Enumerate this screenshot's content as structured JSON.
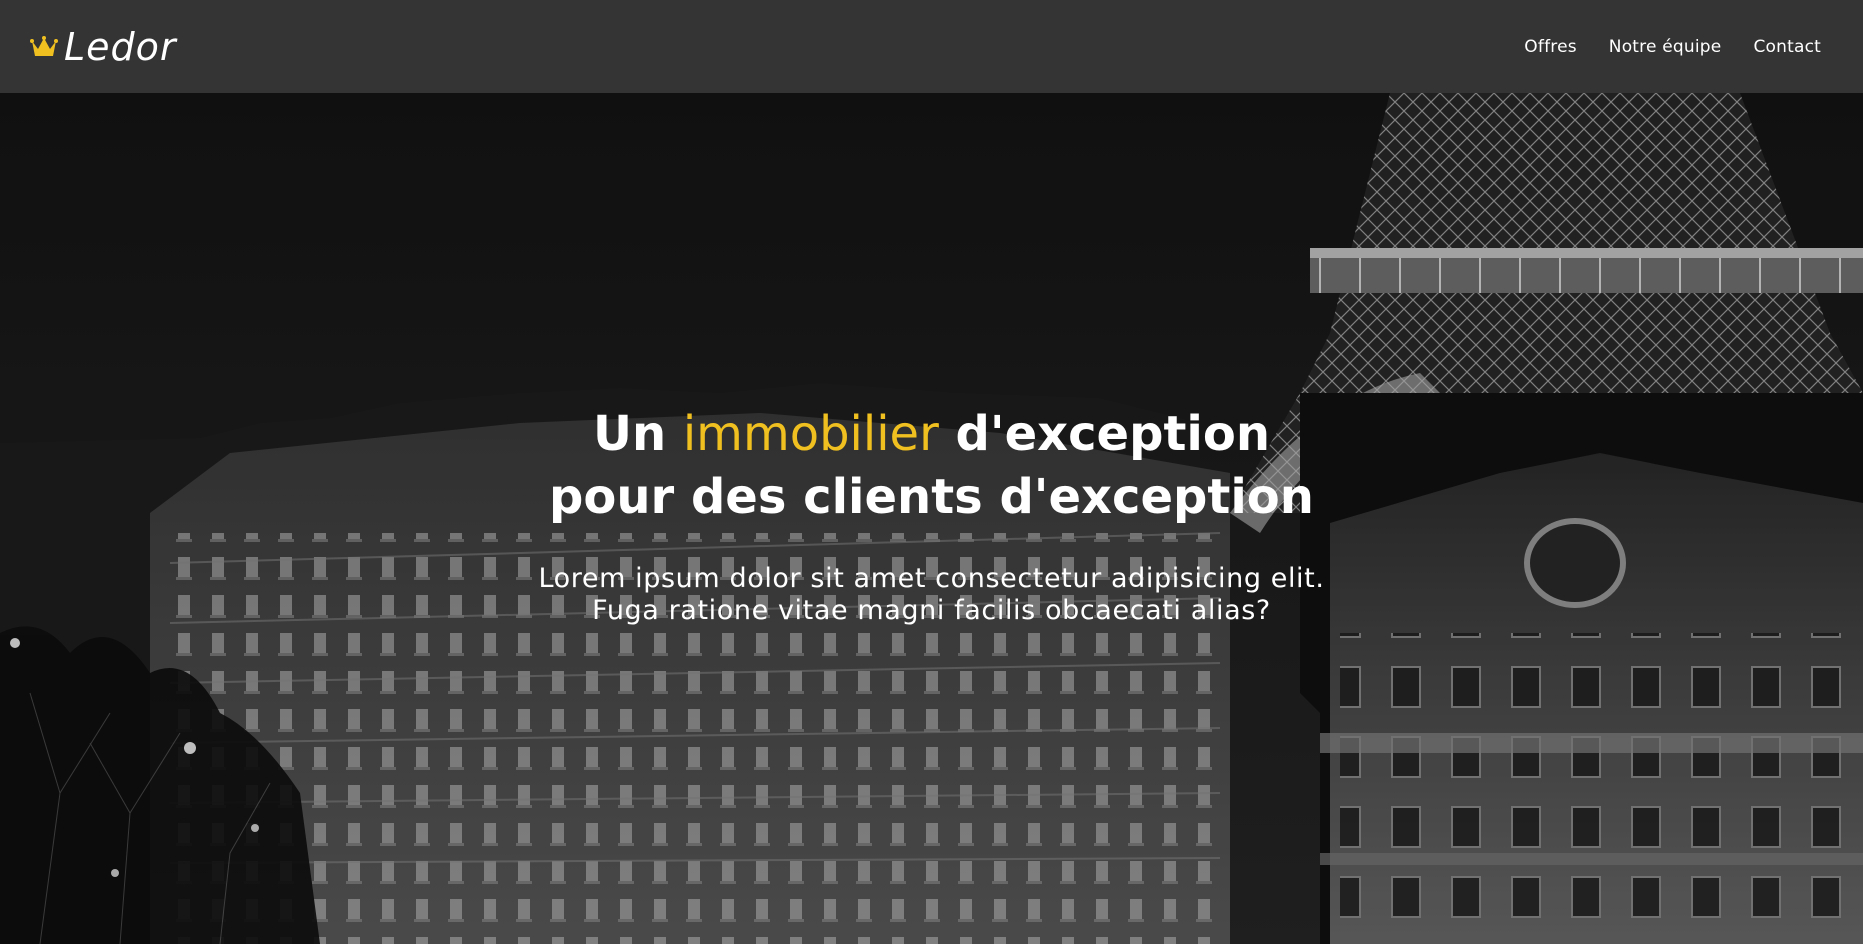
{
  "brand": {
    "name": "Ledor",
    "logo_icon": "crown-icon",
    "accent_color": "#f0c020"
  },
  "nav": {
    "items": [
      {
        "label": "Offres"
      },
      {
        "label": "Notre équipe"
      },
      {
        "label": "Contact"
      }
    ]
  },
  "hero": {
    "title_part1": "Un ",
    "title_accent": "immobilier",
    "title_part2": " d'exception",
    "title_line2": "pour des clients d'exception",
    "subtitle": "Lorem ipsum dolor sit amet consectetur adipisicing elit. Fuga ratione vitae magni facilis obcaecati alias?",
    "background": "black-and-white night photo of Paris buildings and the Eiffel Tower"
  }
}
